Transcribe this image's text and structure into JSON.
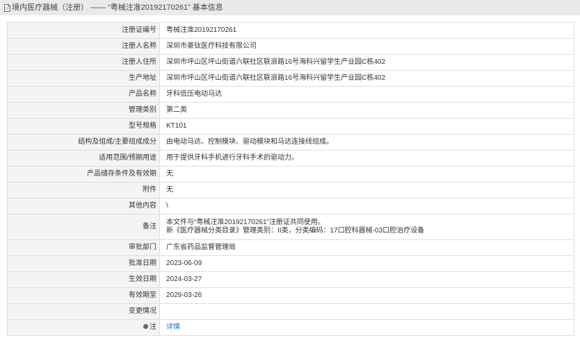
{
  "header": {
    "title": "境内医疗器械（注册） —— “粤械注准20192170261” 基本信息",
    "icon": "document-icon"
  },
  "rows": [
    {
      "label": "注册证编号",
      "value": "粤械注准20192170261"
    },
    {
      "label": "注册人名称",
      "value": "深圳市豪钛医疗科技有限公司"
    },
    {
      "label": "注册人住所",
      "value": "深圳市坪山区坪山街道六联社区联浪路16号海科兴留学生产业园C栋402"
    },
    {
      "label": "生产地址",
      "value": "深圳市坪山区坪山街道六联社区联浪路16号海科兴留学生产业园C栋402"
    },
    {
      "label": "产品名称",
      "value": "牙科低压电动马达"
    },
    {
      "label": "管理类别",
      "value": "第二类"
    },
    {
      "label": "型号规格",
      "value": "KT101"
    },
    {
      "label": "结构及组成/主要组成成分",
      "value": "由电动马达、控制模块、驱动模块和马达连接线组成。"
    },
    {
      "label": "适用范围/预期用途",
      "value": "用于提供牙科手机进行牙科手术的驱动力。"
    },
    {
      "label": "产品储存条件及有效期",
      "value": "无"
    },
    {
      "label": "附件",
      "value": "无"
    },
    {
      "label": "其他内容",
      "value": "\\"
    }
  ],
  "remark": {
    "label": "备注",
    "line1": "本文件与“粤械注准20192170261”注册证共同使用。",
    "line2": "新《医疗器械分类目录》管理类别：II类，分类编码：17口腔科器械-03口腔治疗设备"
  },
  "rows2": [
    {
      "label": "审批部门",
      "value": "广东省药品监督管理局"
    },
    {
      "label": "批准日期",
      "value": "2023-06-09"
    },
    {
      "label": "生效日期",
      "value": "2024-03-27"
    },
    {
      "label": "有效期至",
      "value": "2029-03-26"
    },
    {
      "label": "变更情况",
      "value": ""
    }
  ],
  "note": {
    "label": "注",
    "link": "详情",
    "icon": "location-pin-icon"
  }
}
